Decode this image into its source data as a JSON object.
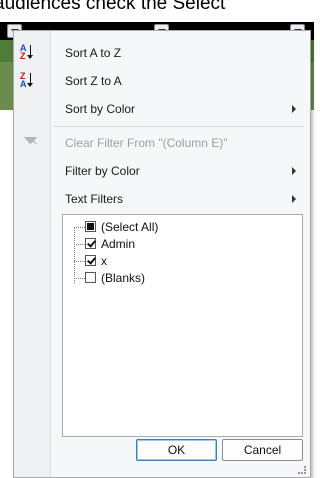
{
  "caption": {
    "text": "audiences check the Select"
  },
  "menu": {
    "items": [
      {
        "label": "Sort A to Z",
        "icon": "sort-a-to-z-icon",
        "disabled": false,
        "submenu": false
      },
      {
        "label": "Sort Z to A",
        "icon": "sort-z-to-a-icon",
        "disabled": false,
        "submenu": false
      },
      {
        "label": "Sort by Color",
        "icon": "",
        "disabled": false,
        "submenu": true
      },
      {
        "label": "Clear Filter From \"(Column E)\"",
        "icon": "clear-filter-icon",
        "disabled": true,
        "submenu": false
      },
      {
        "label": "Filter by Color",
        "icon": "",
        "disabled": false,
        "submenu": true
      },
      {
        "label": "Text Filters",
        "icon": "",
        "disabled": false,
        "submenu": true
      }
    ],
    "icon_glyphs": {
      "a": "A",
      "z": "Z"
    },
    "checklist": [
      {
        "label": "(Select All)",
        "state": "indeterminate"
      },
      {
        "label": "Admin",
        "state": "checked"
      },
      {
        "label": "x",
        "state": "checked"
      },
      {
        "label": "(Blanks)",
        "state": "unchecked"
      }
    ],
    "ok_label": "OK",
    "cancel_label": "Cancel"
  },
  "colors": {
    "header": "#000000",
    "green": "#4f7c3a",
    "menu_bg": "#f6f7f8",
    "ok_border": "#3c7fb1"
  }
}
